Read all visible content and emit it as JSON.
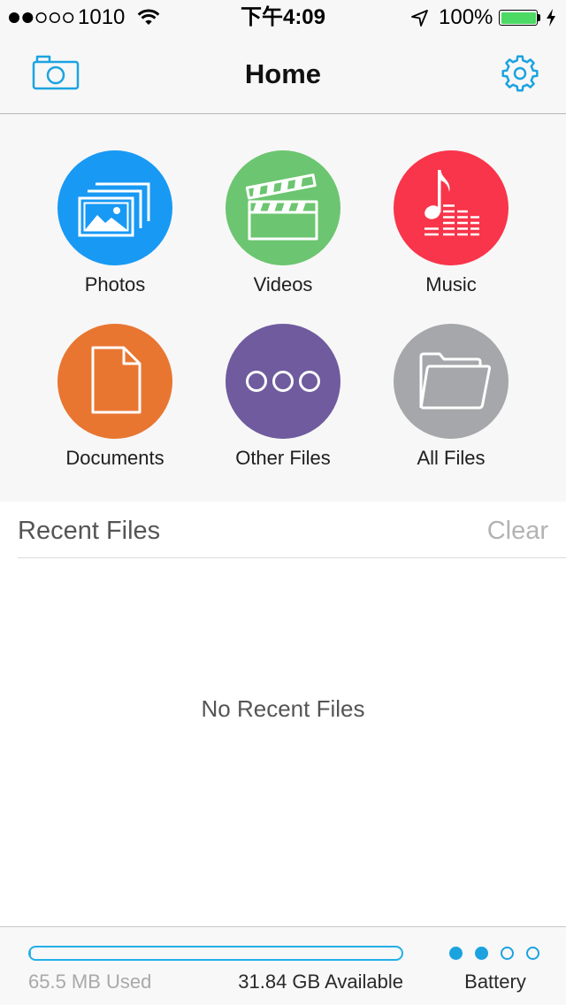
{
  "status_bar": {
    "signal": {
      "filled": 2,
      "total": 5
    },
    "carrier": "1010",
    "time": "下午4:09",
    "battery_percent": "100%",
    "battery_level": 1.0,
    "icons": [
      "wifi-icon",
      "location-arrow-icon",
      "battery-icon",
      "charging-bolt-icon"
    ]
  },
  "nav": {
    "title": "Home",
    "left_icon": "camera-icon",
    "right_icon": "gear-icon"
  },
  "categories": [
    {
      "label": "Photos",
      "icon": "photos-icon",
      "color": "#1899f4"
    },
    {
      "label": "Videos",
      "icon": "clapperboard-icon",
      "color": "#6cc570"
    },
    {
      "label": "Music",
      "icon": "music-note-icon",
      "color": "#f8354a"
    },
    {
      "label": "Documents",
      "icon": "document-icon",
      "color": "#e87631"
    },
    {
      "label": "Other Files",
      "icon": "ellipsis-icon",
      "color": "#6f5b9e"
    },
    {
      "label": "All Files",
      "icon": "folder-icon",
      "color": "#a6a7aa"
    }
  ],
  "recent": {
    "title": "Recent Files",
    "clear_label": "Clear",
    "empty_text": "No Recent Files"
  },
  "storage": {
    "used": "65.5 MB Used",
    "available": "31.84 GB Available",
    "used_fraction": 0.002
  },
  "pager": {
    "label": "Battery",
    "total_dots": 4,
    "filled_dots": 2
  },
  "colors": {
    "accent": "#1ba3e0",
    "progress": "#22b0e6",
    "battery_green": "#4cd964"
  }
}
